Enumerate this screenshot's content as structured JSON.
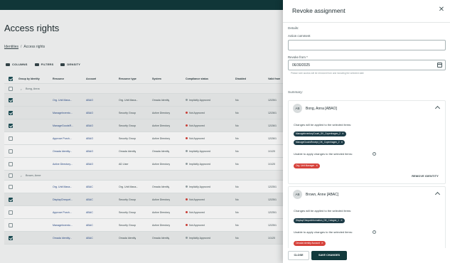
{
  "page": {
    "title": "Access rights",
    "breadcrumbs": [
      "Identities",
      "Access rights"
    ],
    "toolbar": [
      "COLUMNS",
      "FILTERS",
      "DENSITY"
    ],
    "columns": [
      "Group by Identity",
      "Resource",
      "Account",
      "Resource type",
      "System",
      "Compliance status",
      "Disabled",
      "Valid from"
    ],
    "groups": [
      {
        "label": "Bong, Anna",
        "rows": [
          {
            "selected": true,
            "resource": "Org. Unit Mana...",
            "account": "ABAO",
            "type": "Org. Unit Mana...",
            "system": "Omada Identity",
            "status": "Implicitly Approved",
            "status_color": "#9aa6a9",
            "disabled": "No",
            "valid": "12/25/1"
          },
          {
            "selected": true,
            "resource": "ManageInvento...",
            "account": "ABAO",
            "type": "Security Group",
            "system": "Active Directory",
            "status": "Not Approved",
            "status_color": "#d6423b",
            "disabled": "No",
            "valid": "12/26/1"
          },
          {
            "selected": true,
            "resource": "ManageGoodsR...",
            "account": "ABAO",
            "type": "Security Group",
            "system": "Active Directory",
            "status": "Not Approved",
            "status_color": "#d6423b",
            "disabled": "No",
            "valid": "12/26/1"
          },
          {
            "selected": false,
            "resource": "Approve Purch...",
            "account": "ABAO",
            "type": "Security Group",
            "system": "Active Directory",
            "status": "Not Approved",
            "status_color": "#d6423b",
            "disabled": "No",
            "valid": "12/26/1"
          },
          {
            "selected": false,
            "resource": "Omada Identity...",
            "account": "ABAO",
            "type": "Omada Identity",
            "system": "Omada Identity",
            "status": "Implicitly Approved",
            "status_color": "#9aa6a9",
            "disabled": "No",
            "valid": "1/1/20"
          },
          {
            "selected": false,
            "resource": "Active Directory...",
            "account": "ABAO",
            "type": "AD User",
            "system": "Active Directory",
            "status": "Implicitly Approved",
            "status_color": "#9aa6a9",
            "disabled": "No",
            "valid": "1/1/20"
          }
        ]
      },
      {
        "label": "Brown, Anne",
        "rows": [
          {
            "selected": false,
            "resource": "Org. Unit Mana...",
            "account": "ABAC",
            "type": "Org. Unit Mana...",
            "system": "Omada Identity",
            "status": "Implicitly Approved",
            "status_color": "#9aa6a9",
            "disabled": "No",
            "valid": "12/25/1"
          },
          {
            "selected": true,
            "resource": "DisplayChequeI...",
            "account": "ABAC",
            "type": "Security Group",
            "system": "Active Directory",
            "status": "Not Approved",
            "status_color": "#d6423b",
            "disabled": "No",
            "valid": "12/25/1"
          },
          {
            "selected": false,
            "resource": "Approve Purch...",
            "account": "ABAC",
            "type": "Security Group",
            "system": "Active Directory",
            "status": "Not Approved",
            "status_color": "#d6423b",
            "disabled": "No",
            "valid": "12/25/1"
          },
          {
            "selected": false,
            "resource": "ManageInvento...",
            "account": "ABAC",
            "type": "Security Group",
            "system": "Active Directory",
            "status": "Not Approved",
            "status_color": "#d6423b",
            "disabled": "No",
            "valid": "12/25/1"
          },
          {
            "selected": true,
            "resource": "Omada Identity...",
            "account": "ABAC",
            "type": "Omada Identity",
            "system": "Omada Identity",
            "status": "Implicitly Approved",
            "status_color": "#9aa6a9",
            "disabled": "No",
            "valid": "1/1/20"
          }
        ]
      }
    ]
  },
  "drawer": {
    "title": "Revoke assignment",
    "details_label": "Details:",
    "comment_label": "Action comment",
    "comment_value": "",
    "revoke_label": "Revoke from *",
    "revoke_value": "06/30/2025",
    "helper": "Please note access will be removed from and including the selected date",
    "summary_label": "Summary:",
    "cards": [
      {
        "initials": "AB",
        "name": "Bong, Anna [ABAO]",
        "applied_label": "Changes will be applied to the selected items:",
        "applied_chips": [
          "ManageInventoryCount_DK_Copenhagen_2",
          "ManageGoodsReceipt_DK_Copenhagen_2"
        ],
        "unable_label": "Unable to apply changes to the selected items:",
        "unable_chips": [
          "Org. Unit Manager"
        ],
        "remove_label": "REMOVE IDENTITY"
      },
      {
        "initials": "AB",
        "name": "Brown, Anne [ABAC]",
        "applied_label": "Changes will be applied to the selected items:",
        "applied_chips": [
          "DisplayChequeInformation_DK_Cologne_1"
        ],
        "unable_label": "Unable to apply changes to the selected items:",
        "unable_chips": [
          "Omada Identity Account"
        ]
      }
    ],
    "close_label": "CLOSE",
    "save_label": "SAVE CHANGES"
  }
}
